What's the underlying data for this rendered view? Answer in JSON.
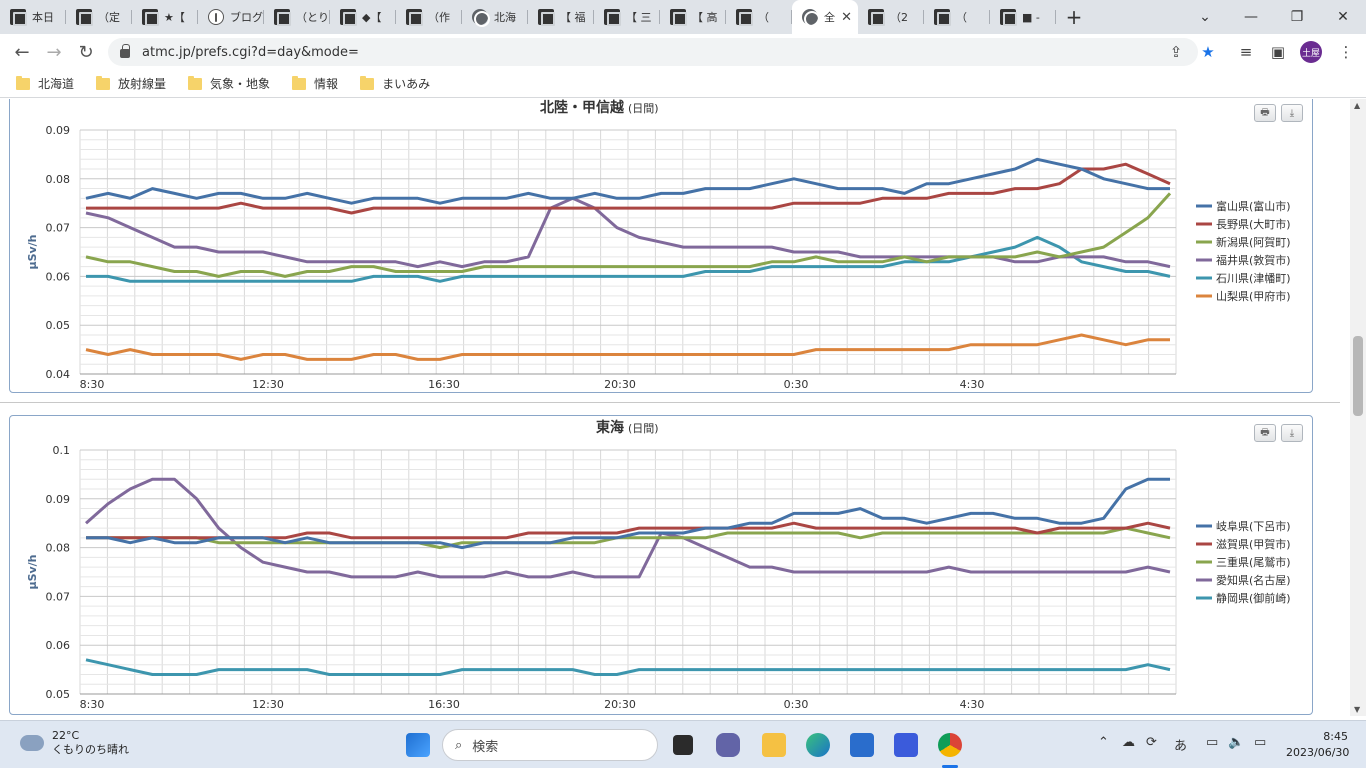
{
  "browser": {
    "tabs": [
      {
        "label": "本日",
        "icon": "site-icon"
      },
      {
        "label": "（定",
        "icon": "site-icon"
      },
      {
        "label": "★【",
        "icon": "site-icon"
      },
      {
        "label": "ブログ",
        "icon": "info-icon"
      },
      {
        "label": "（とり",
        "icon": "site-icon"
      },
      {
        "label": "◆【",
        "icon": "site-icon"
      },
      {
        "label": "（作",
        "icon": "site-icon"
      },
      {
        "label": "北海",
        "icon": "globe-icon"
      },
      {
        "label": "【 福",
        "icon": "site-icon"
      },
      {
        "label": "【 三",
        "icon": "site-icon"
      },
      {
        "label": "【 高",
        "icon": "site-icon"
      },
      {
        "label": "（",
        "icon": "site-icon"
      },
      {
        "label": "全",
        "icon": "globe-icon",
        "active": true
      },
      {
        "label": "（2",
        "icon": "site-icon"
      },
      {
        "label": "（",
        "icon": "site-icon"
      },
      {
        "label": "■ -",
        "icon": "site-icon"
      }
    ],
    "new_tab": "+",
    "url": "atmc.jp/prefs.cgi?d=day&mode=",
    "profile": "土屋",
    "bookmarks": [
      "北海道",
      "放射線量",
      "気象・地象",
      "情報",
      "まいあみ"
    ]
  },
  "charts": {
    "period_label": "(日間)",
    "print_label": "🖶",
    "download_label": "⤓",
    "x_ticks": [
      "8:30",
      "12:30",
      "16:30",
      "20:30",
      "0:30",
      "4:30"
    ]
  },
  "chart_data": [
    {
      "type": "line",
      "title": "北陸・甲信越",
      "ylabel": "μSv/h",
      "ylim": [
        0.04,
        0.09
      ],
      "yticks": [
        "0.09",
        "0.08",
        "0.07",
        "0.06",
        "0.05",
        "0.04"
      ],
      "legend_position": "right",
      "series": [
        {
          "name": "富山県(富山市)",
          "color": "#4572a7",
          "values": [
            0.076,
            0.077,
            0.076,
            0.078,
            0.077,
            0.076,
            0.077,
            0.077,
            0.076,
            0.076,
            0.077,
            0.076,
            0.075,
            0.076,
            0.076,
            0.076,
            0.075,
            0.076,
            0.076,
            0.076,
            0.077,
            0.076,
            0.076,
            0.077,
            0.076,
            0.076,
            0.077,
            0.077,
            0.078,
            0.078,
            0.078,
            0.079,
            0.08,
            0.079,
            0.078,
            0.078,
            0.078,
            0.077,
            0.079,
            0.079,
            0.08,
            0.081,
            0.082,
            0.084,
            0.083,
            0.082,
            0.08,
            0.079,
            0.078,
            0.078
          ]
        },
        {
          "name": "長野県(大町市)",
          "color": "#aa4643",
          "values": [
            0.074,
            0.074,
            0.074,
            0.074,
            0.074,
            0.074,
            0.074,
            0.075,
            0.074,
            0.074,
            0.074,
            0.074,
            0.073,
            0.074,
            0.074,
            0.074,
            0.074,
            0.074,
            0.074,
            0.074,
            0.074,
            0.074,
            0.074,
            0.074,
            0.074,
            0.074,
            0.074,
            0.074,
            0.074,
            0.074,
            0.074,
            0.074,
            0.075,
            0.075,
            0.075,
            0.075,
            0.076,
            0.076,
            0.076,
            0.077,
            0.077,
            0.077,
            0.078,
            0.078,
            0.079,
            0.082,
            0.082,
            0.083,
            0.081,
            0.079
          ]
        },
        {
          "name": "新潟県(阿賀町)",
          "color": "#89a54e",
          "values": [
            0.064,
            0.063,
            0.063,
            0.062,
            0.061,
            0.061,
            0.06,
            0.061,
            0.061,
            0.06,
            0.061,
            0.061,
            0.062,
            0.062,
            0.061,
            0.061,
            0.061,
            0.061,
            0.062,
            0.062,
            0.062,
            0.062,
            0.062,
            0.062,
            0.062,
            0.062,
            0.062,
            0.062,
            0.062,
            0.062,
            0.062,
            0.063,
            0.063,
            0.064,
            0.063,
            0.063,
            0.063,
            0.064,
            0.063,
            0.064,
            0.064,
            0.064,
            0.064,
            0.065,
            0.064,
            0.065,
            0.066,
            0.069,
            0.072,
            0.077
          ]
        },
        {
          "name": "福井県(敦賀市)",
          "color": "#80699b",
          "values": [
            0.073,
            0.072,
            0.07,
            0.068,
            0.066,
            0.066,
            0.065,
            0.065,
            0.065,
            0.064,
            0.063,
            0.063,
            0.063,
            0.063,
            0.063,
            0.062,
            0.063,
            0.062,
            0.063,
            0.063,
            0.064,
            0.074,
            0.076,
            0.074,
            0.07,
            0.068,
            0.067,
            0.066,
            0.066,
            0.066,
            0.066,
            0.066,
            0.065,
            0.065,
            0.065,
            0.064,
            0.064,
            0.064,
            0.064,
            0.064,
            0.064,
            0.064,
            0.063,
            0.063,
            0.064,
            0.064,
            0.064,
            0.063,
            0.063,
            0.062
          ]
        },
        {
          "name": "石川県(津幡町)",
          "color": "#3d96ae",
          "values": [
            0.06,
            0.06,
            0.059,
            0.059,
            0.059,
            0.059,
            0.059,
            0.059,
            0.059,
            0.059,
            0.059,
            0.059,
            0.059,
            0.06,
            0.06,
            0.06,
            0.059,
            0.06,
            0.06,
            0.06,
            0.06,
            0.06,
            0.06,
            0.06,
            0.06,
            0.06,
            0.06,
            0.06,
            0.061,
            0.061,
            0.061,
            0.062,
            0.062,
            0.062,
            0.062,
            0.062,
            0.062,
            0.063,
            0.063,
            0.063,
            0.064,
            0.065,
            0.066,
            0.068,
            0.066,
            0.063,
            0.062,
            0.061,
            0.061,
            0.06
          ]
        },
        {
          "name": "山梨県(甲府市)",
          "color": "#db843d",
          "values": [
            0.045,
            0.044,
            0.045,
            0.044,
            0.044,
            0.044,
            0.044,
            0.043,
            0.044,
            0.044,
            0.043,
            0.043,
            0.043,
            0.044,
            0.044,
            0.043,
            0.043,
            0.044,
            0.044,
            0.044,
            0.044,
            0.044,
            0.044,
            0.044,
            0.044,
            0.044,
            0.044,
            0.044,
            0.044,
            0.044,
            0.044,
            0.044,
            0.044,
            0.045,
            0.045,
            0.045,
            0.045,
            0.045,
            0.045,
            0.045,
            0.046,
            0.046,
            0.046,
            0.046,
            0.047,
            0.048,
            0.047,
            0.046,
            0.047,
            0.047
          ]
        }
      ]
    },
    {
      "type": "line",
      "title": "東海",
      "ylabel": "μSv/h",
      "ylim": [
        0.05,
        0.1
      ],
      "yticks": [
        "0.1",
        "0.09",
        "0.08",
        "0.07",
        "0.06",
        "0.05"
      ],
      "legend_position": "right",
      "series": [
        {
          "name": "岐阜県(下呂市)",
          "color": "#4572a7",
          "values": [
            0.082,
            0.082,
            0.081,
            0.082,
            0.081,
            0.081,
            0.082,
            0.082,
            0.082,
            0.081,
            0.082,
            0.081,
            0.081,
            0.081,
            0.081,
            0.081,
            0.081,
            0.08,
            0.081,
            0.081,
            0.081,
            0.081,
            0.082,
            0.082,
            0.082,
            0.083,
            0.083,
            0.083,
            0.084,
            0.084,
            0.085,
            0.085,
            0.087,
            0.087,
            0.087,
            0.088,
            0.086,
            0.086,
            0.085,
            0.086,
            0.087,
            0.087,
            0.086,
            0.086,
            0.085,
            0.085,
            0.086,
            0.092,
            0.094,
            0.094
          ]
        },
        {
          "name": "滋賀県(甲賀市)",
          "color": "#aa4643",
          "values": [
            0.082,
            0.082,
            0.082,
            0.082,
            0.082,
            0.082,
            0.082,
            0.082,
            0.082,
            0.082,
            0.083,
            0.083,
            0.082,
            0.082,
            0.082,
            0.082,
            0.082,
            0.082,
            0.082,
            0.082,
            0.083,
            0.083,
            0.083,
            0.083,
            0.083,
            0.084,
            0.084,
            0.084,
            0.084,
            0.084,
            0.084,
            0.084,
            0.085,
            0.084,
            0.084,
            0.084,
            0.084,
            0.084,
            0.084,
            0.084,
            0.084,
            0.084,
            0.084,
            0.083,
            0.084,
            0.084,
            0.084,
            0.084,
            0.085,
            0.084
          ]
        },
        {
          "name": "三重県(尾鷲市)",
          "color": "#89a54e",
          "values": [
            0.082,
            0.082,
            0.082,
            0.082,
            0.082,
            0.082,
            0.081,
            0.081,
            0.081,
            0.081,
            0.081,
            0.081,
            0.081,
            0.081,
            0.081,
            0.081,
            0.08,
            0.081,
            0.081,
            0.081,
            0.081,
            0.081,
            0.081,
            0.081,
            0.082,
            0.082,
            0.082,
            0.082,
            0.082,
            0.083,
            0.083,
            0.083,
            0.083,
            0.083,
            0.083,
            0.082,
            0.083,
            0.083,
            0.083,
            0.083,
            0.083,
            0.083,
            0.083,
            0.083,
            0.083,
            0.083,
            0.083,
            0.084,
            0.083,
            0.082
          ]
        },
        {
          "name": "愛知県(名古屋)",
          "color": "#80699b",
          "values": [
            0.085,
            0.089,
            0.092,
            0.094,
            0.094,
            0.09,
            0.084,
            0.08,
            0.077,
            0.076,
            0.075,
            0.075,
            0.074,
            0.074,
            0.074,
            0.075,
            0.074,
            0.074,
            0.074,
            0.075,
            0.074,
            0.074,
            0.075,
            0.074,
            0.074,
            0.074,
            0.083,
            0.082,
            0.08,
            0.078,
            0.076,
            0.076,
            0.075,
            0.075,
            0.075,
            0.075,
            0.075,
            0.075,
            0.075,
            0.076,
            0.075,
            0.075,
            0.075,
            0.075,
            0.075,
            0.075,
            0.075,
            0.075,
            0.076,
            0.075
          ]
        },
        {
          "name": "静岡県(御前崎)",
          "color": "#3d96ae",
          "values": [
            0.057,
            0.056,
            0.055,
            0.054,
            0.054,
            0.054,
            0.055,
            0.055,
            0.055,
            0.055,
            0.055,
            0.054,
            0.054,
            0.054,
            0.054,
            0.054,
            0.054,
            0.055,
            0.055,
            0.055,
            0.055,
            0.055,
            0.055,
            0.054,
            0.054,
            0.055,
            0.055,
            0.055,
            0.055,
            0.055,
            0.055,
            0.055,
            0.055,
            0.055,
            0.055,
            0.055,
            0.055,
            0.055,
            0.055,
            0.055,
            0.055,
            0.055,
            0.055,
            0.055,
            0.055,
            0.055,
            0.055,
            0.055,
            0.056,
            0.055
          ]
        }
      ]
    }
  ],
  "taskbar": {
    "temperature": "22°C",
    "weather_text": "くもりのち晴れ",
    "search_label": "検索",
    "time": "8:45",
    "date": "2023/06/30",
    "ime": "あ"
  }
}
